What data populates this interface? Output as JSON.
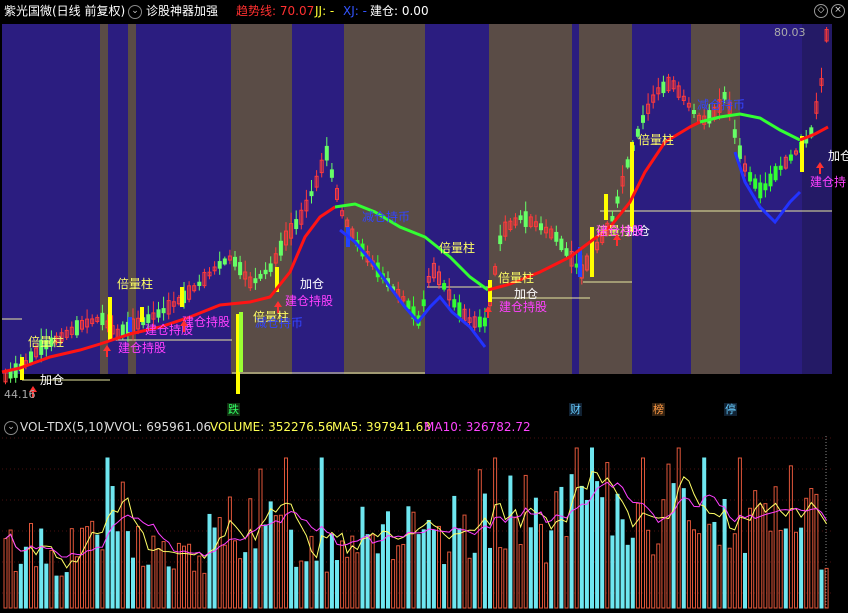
{
  "header": {
    "title": "紫光国微(日线 前复权)",
    "indicator_name": "诊股神器加强",
    "trend_label": "趋势线: 70.07",
    "jj_label": "JJ: -",
    "xj_label": "XJ: -",
    "jiancang_label": "建仓: 0.00"
  },
  "colors": {
    "background": "#000000",
    "band_purple": "#2b1d80",
    "band_gray": "#5a4c46",
    "up_candle": "#ff3a3a",
    "down_candle": "#00c8ff",
    "trend_red": "#ff1414",
    "trend_green": "#33ff33",
    "trend_blue": "#2233ff",
    "vol_bar_up": "#e0563a",
    "vol_bar_down": "#6ee6f0",
    "ma5": "#ffff66",
    "ma10": "#ff40ff"
  },
  "events": [
    {
      "label": "跌",
      "color": "#33ff66"
    },
    {
      "label": "财",
      "color": "#66ccff"
    },
    {
      "label": "榜",
      "color": "#ff9944"
    },
    {
      "label": "停",
      "color": "#66ccff"
    }
  ],
  "vol_header": {
    "name": "VOL-TDX(5,10)",
    "vvol": "VVOL: 695961.06",
    "volume": "VOLUME: 352276.56",
    "ma5": "MA5: 397941.63",
    "ma10": "MA10: 326782.72"
  },
  "chart_data": {
    "type": "candlestick",
    "price_high_label": "80.03",
    "price_low_label": "44.16",
    "price_range": [
      44.16,
      80.03
    ],
    "annotations": [
      {
        "text": "倍量柱",
        "color": "#ffff66"
      },
      {
        "text": "加仓",
        "color": "#ffffff"
      },
      {
        "text": "建仓持股",
        "color": "#ff40ff"
      },
      {
        "text": "减仓持币",
        "color": "#3344ff"
      },
      {
        "text": "建仓持",
        "color": "#ff40ff"
      }
    ],
    "volume": {
      "series": [
        "VOLUME",
        "MA5",
        "MA10"
      ]
    }
  }
}
